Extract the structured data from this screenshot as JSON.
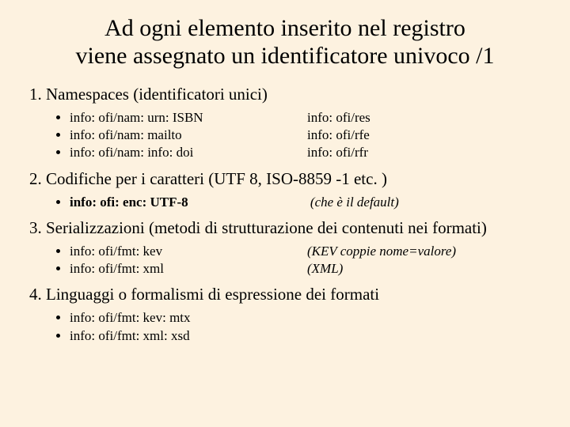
{
  "title_line1": "Ad ogni elemento inserito nel registro",
  "title_line2": "viene assegnato un identificatore univoco /1",
  "items": [
    {
      "heading": "Namespaces (identificatori unici)",
      "rows": [
        {
          "left": "info: ofi/nam: urn: ISBN",
          "right": "info: ofi/res"
        },
        {
          "left": "info: ofi/nam: mailto",
          "right": "info: ofi/rfe"
        },
        {
          "left": "info: ofi/nam: info: doi",
          "right": "info: ofi/rfr"
        }
      ]
    },
    {
      "heading": "Codifiche per i caratteri (UTF 8, ISO-8859 -1 etc. )",
      "single": {
        "left": "info: ofi: enc: UTF-8",
        "right": "(che è il default)"
      }
    },
    {
      "heading": "Serializzazioni (metodi di strutturazione dei contenuti nei formati)",
      "rows": [
        {
          "left": "info: ofi/fmt: kev",
          "right": "(KEV coppie nome=valore)"
        },
        {
          "left": "info: ofi/fmt: xml",
          "right": "(XML)"
        }
      ]
    },
    {
      "heading": "Linguaggi o formalismi di espressione dei formati",
      "plain": [
        "info: ofi/fmt: kev: mtx",
        "info: ofi/fmt: xml: xsd"
      ]
    }
  ]
}
